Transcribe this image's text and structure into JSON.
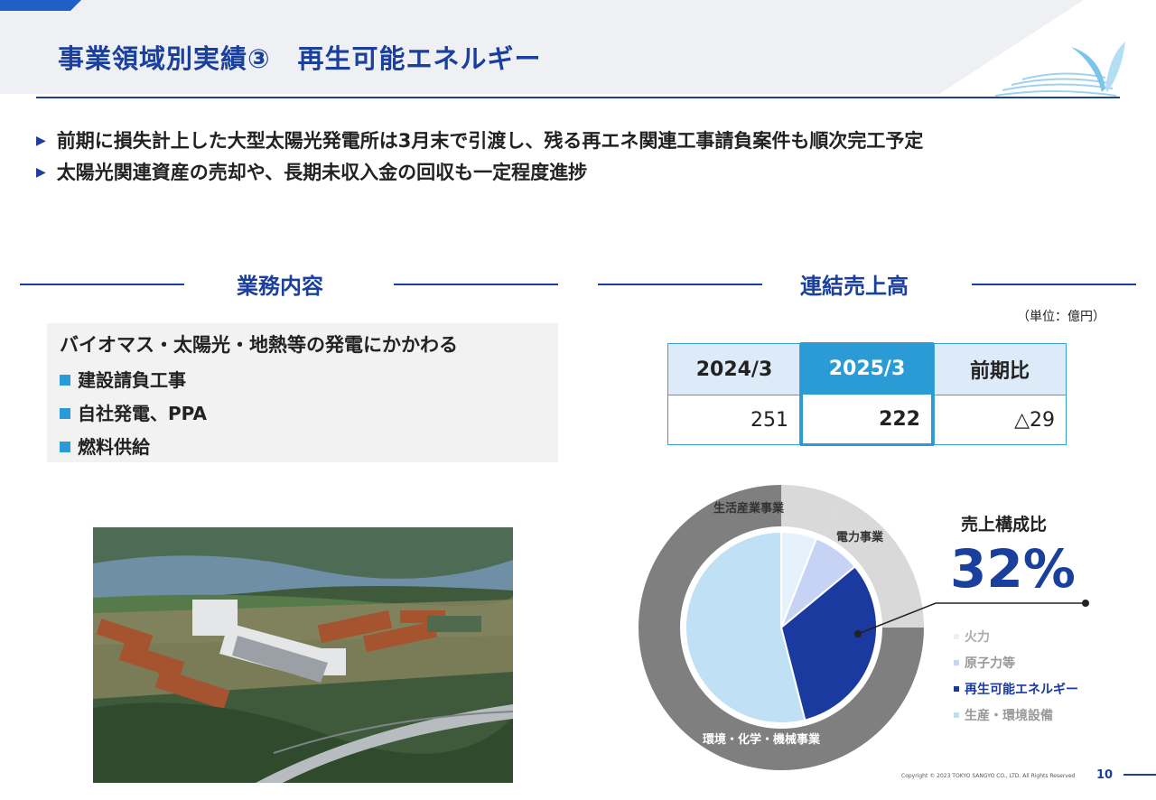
{
  "header": {
    "title": "事業領域別実績③　再生可能エネルギー"
  },
  "bullets": [
    "前期に損失計上した大型太陽光発電所は3月末で引渡し、残る再エネ関連工事請負案件も順次完工予定",
    "太陽光関連資産の売却や、長期未収入金の回収も一定程度進捗"
  ],
  "business": {
    "section_title": "業務内容",
    "lead": "バイオマス・太陽光・地熱等の発電にかかわる",
    "items": [
      "建設請負工事",
      "自社発電、PPA",
      "燃料供給"
    ]
  },
  "sales": {
    "section_title": "連結売上高",
    "unit": "（単位：億円）",
    "headers": [
      "2024/3",
      "2025/3",
      "前期比"
    ],
    "values": [
      "251",
      "222",
      "△29"
    ]
  },
  "composition": {
    "outer_labels": {
      "lifestyle": "生活産業事業",
      "power": "電力事業",
      "env": "環境・化学・機械事業"
    },
    "ratio_title": "売上構成比",
    "ratio_value": "32%",
    "legend": [
      "火力",
      "原子力等",
      "再生可能エネルギー",
      "生産・環境設備"
    ],
    "colors": {
      "thermal": "#e6f2fb",
      "nuclear": "#c7d3f4",
      "renewable": "#1b3aa0",
      "production": "#bfe0f5",
      "outer_gray": "#7f7f7f",
      "outer_light": "#d9d9d9"
    }
  },
  "chart_data": {
    "type": "pie",
    "title": "売上構成比",
    "series": [
      {
        "name": "火力",
        "value": 6
      },
      {
        "name": "原子力等",
        "value": 8
      },
      {
        "name": "再生可能エネルギー",
        "value": 32
      },
      {
        "name": "生産・環境設備",
        "value": 54
      }
    ],
    "highlight": "再生可能エネルギー",
    "highlight_value": "32%",
    "outer_ring": [
      {
        "name": "生活産業事業",
        "value": 7
      },
      {
        "name": "電力事業",
        "value": 18
      },
      {
        "name": "環境・化学・機械事業",
        "value": 75
      }
    ]
  },
  "footer": {
    "copyright": "Copyright © 2023 TOKYO SANGYO CO., LTD. All Rights Reserved",
    "page": "10"
  }
}
